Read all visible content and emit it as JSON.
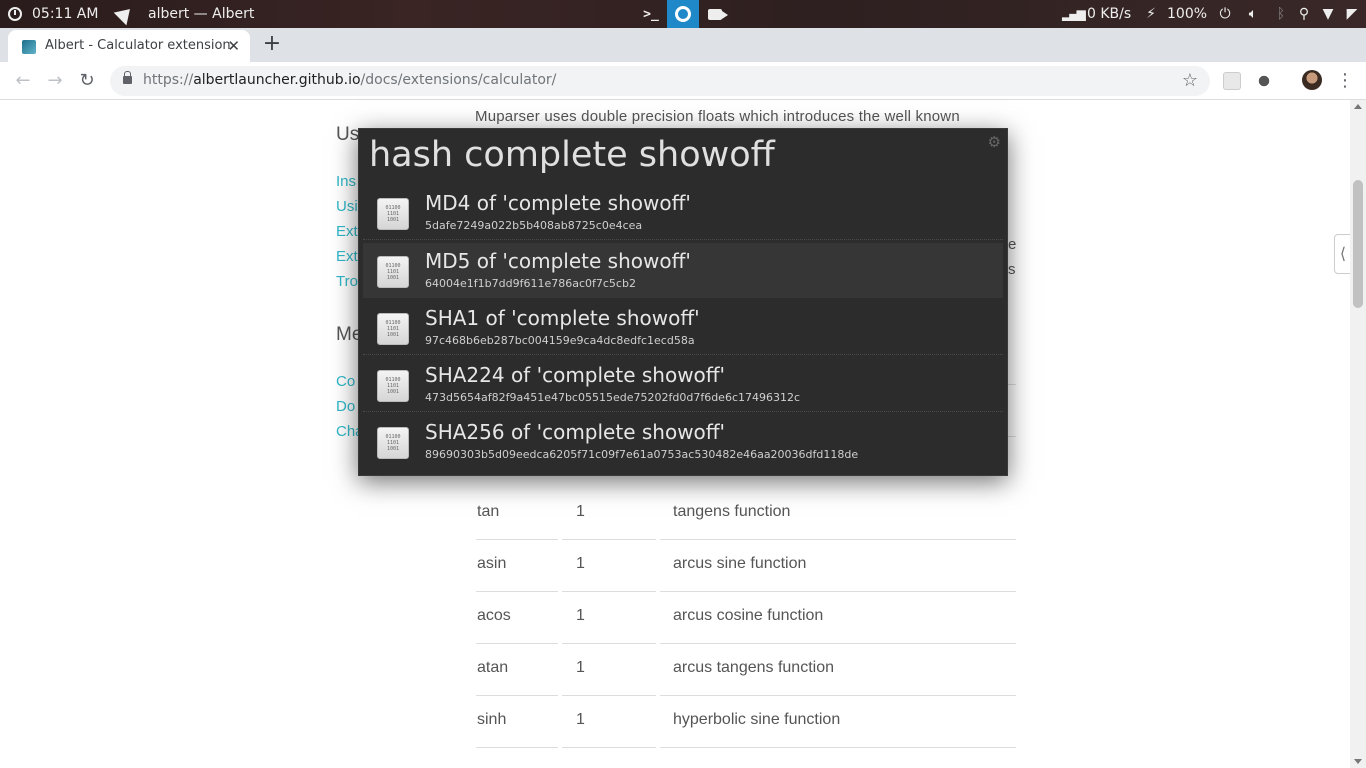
{
  "system_panel": {
    "time": "05:11 AM",
    "active_window": "albert — Albert",
    "network_speed": "0 KB/s",
    "battery": "100%"
  },
  "browser": {
    "tab_title": "Albert - Calculator extension",
    "url_scheme": "https://",
    "url_host": "albertlauncher.github.io",
    "url_path": "/docs/extensions/calculator/"
  },
  "page": {
    "intro_text": "Muparser uses double precision floats which introduces the well known",
    "frag_right_1": "e",
    "frag_right_2": "s",
    "sidebar": {
      "heading_1": "Us",
      "links_1": [
        "Ins",
        "Usi",
        "Ext",
        "Ext",
        "Tro"
      ],
      "heading_2": "Me",
      "links_2": [
        "Co",
        "Do",
        "Cha"
      ]
    },
    "functions_table": [
      {
        "name": "tan",
        "args": "1",
        "desc": "tangens function"
      },
      {
        "name": "asin",
        "args": "1",
        "desc": "arcus sine function"
      },
      {
        "name": "acos",
        "args": "1",
        "desc": "arcus cosine function"
      },
      {
        "name": "atan",
        "args": "1",
        "desc": "arcus tangens function"
      },
      {
        "name": "sinh",
        "args": "1",
        "desc": "hyperbolic sine function"
      }
    ]
  },
  "albert": {
    "query": "hash complete showoff",
    "results": [
      {
        "title": "MD4 of 'complete showoff'",
        "subtitle": "5dafe7249a022b5b408ab8725c0e4cea",
        "icon": "binary-file-icon",
        "selected": false
      },
      {
        "title": "MD5 of 'complete showoff'",
        "subtitle": "64004e1f1b7dd9f611e786ac0f7c5cb2",
        "icon": "binary-file-icon",
        "selected": true
      },
      {
        "title": "SHA1 of 'complete showoff'",
        "subtitle": "97c468b6eb287bc004159e9ca4dc8edfc1ecd58a",
        "icon": "binary-file-icon",
        "selected": false
      },
      {
        "title": "SHA224 of 'complete showoff'",
        "subtitle": "473d5654af82f9a451e47bc05515ede75202fd0d7f6de6c17496312c",
        "icon": "binary-file-icon",
        "selected": false
      },
      {
        "title": "SHA256 of 'complete showoff'",
        "subtitle": "89690303b5d09eedca6205f71c09f7e61a0753ac530482e46aa20036dfd118de",
        "icon": "binary-file-icon",
        "selected": false
      }
    ]
  },
  "colors": {
    "link": "#2fb8c8",
    "albert_bg": "#2c2c2c",
    "albert_selected": "#363636",
    "active_taskbar": "#1e88c8"
  }
}
